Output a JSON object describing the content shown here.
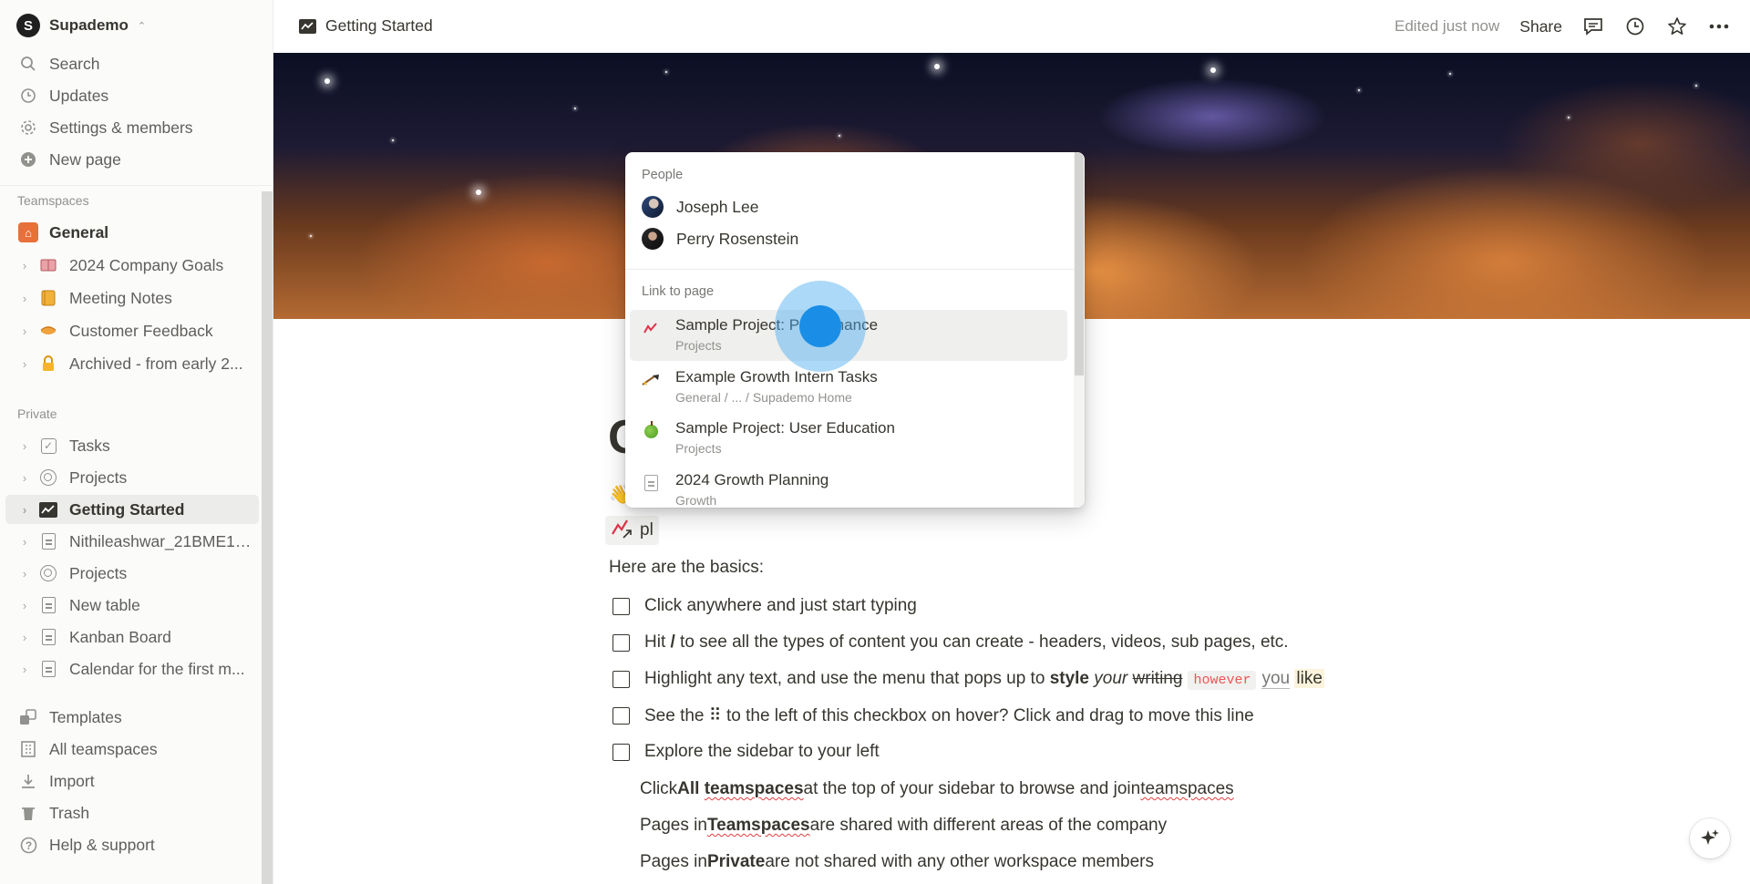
{
  "workspace": {
    "name": "Supademo",
    "logo_letter": "S"
  },
  "sidebar": {
    "top_items": [
      {
        "label": "Search",
        "icon": "search-icon"
      },
      {
        "label": "Updates",
        "icon": "clock-icon"
      },
      {
        "label": "Settings & members",
        "icon": "gear-icon"
      },
      {
        "label": "New page",
        "icon": "plus-circle-icon"
      }
    ],
    "teamspaces_label": "Teamspaces",
    "teamspaces": [
      {
        "label": "General",
        "icon": "home-icon"
      },
      {
        "label": "2024 Company Goals",
        "icon": "book-icon"
      },
      {
        "label": "Meeting Notes",
        "icon": "notebook-icon"
      },
      {
        "label": "Customer Feedback",
        "icon": "pie-icon"
      },
      {
        "label": "Archived - from early 2...",
        "icon": "lock-icon"
      }
    ],
    "private_label": "Private",
    "private": [
      {
        "label": "Tasks",
        "icon": "checkbox-icon"
      },
      {
        "label": "Projects",
        "icon": "target-icon"
      },
      {
        "label": "Getting Started",
        "icon": "chart-icon"
      },
      {
        "label": "Nithileashwar_21BME10...",
        "icon": "document-icon"
      },
      {
        "label": "Projects",
        "icon": "target-icon"
      },
      {
        "label": "New table",
        "icon": "document-icon"
      },
      {
        "label": "Kanban Board",
        "icon": "document-icon"
      },
      {
        "label": "Calendar for the first m...",
        "icon": "document-icon"
      }
    ],
    "bottom_items": [
      {
        "label": "Templates",
        "icon": "templates-icon"
      },
      {
        "label": "All teamspaces",
        "icon": "building-icon"
      },
      {
        "label": "Import",
        "icon": "download-icon"
      },
      {
        "label": "Trash",
        "icon": "trash-icon"
      },
      {
        "label": "Help & support",
        "icon": "help-icon"
      }
    ]
  },
  "topbar": {
    "breadcrumb": "Getting Started",
    "edited": "Edited just now",
    "share": "Share"
  },
  "popup": {
    "people_label": "People",
    "people": [
      "Joseph Lee",
      "Perry Rosenstein"
    ],
    "link_label": "Link to page",
    "pages": [
      {
        "title": "Sample Project: Performance",
        "subtitle": "Projects"
      },
      {
        "title": "Example Growth Intern Tasks",
        "subtitle": "General / ... / Supademo Home"
      },
      {
        "title": "Sample Project: User Education",
        "subtitle": "Projects"
      },
      {
        "title": "2024 Growth Planning",
        "subtitle": "Growth"
      }
    ]
  },
  "doc": {
    "title_fragment": "G",
    "emoji_fragment": "👋",
    "mention_query": "pl",
    "basics": "Here are the basics:",
    "todos": {
      "t1": "Click anywhere and just start typing",
      "t2_a": "Hit ",
      "t2_b": "/",
      "t2_c": " to see all the types of content you can create - headers, videos, sub pages, etc.",
      "t3_a": "Highlight any text, and use the menu that pops up to ",
      "t3_style": "style",
      "t3_your": "your",
      "t3_writing": "writing",
      "t3_however": "however",
      "t3_you": "you",
      "t3_like": "like",
      "t4": "See the ⠿ to the left of this checkbox on hover? Click and drag to move this line",
      "t5": "Explore the sidebar to your left"
    },
    "subs": {
      "s1_a": "Click ",
      "s1_b": "All",
      "s1_c": "teamspaces",
      "s1_d": " at the top of your sidebar to browse and join ",
      "s1_e": "teamspaces",
      "s2_a": "Pages in ",
      "s2_b": "Teamspaces",
      "s2_c": " are shared with different areas of the company",
      "s3_a": "Pages in ",
      "s3_b": "Private",
      "s3_c": " are not shared with any other workspace members"
    }
  },
  "colors": {
    "accent": "#1a8ee6",
    "sidebar_bg": "#fbfbfa",
    "text": "#37352f",
    "muted": "#91918e",
    "code_red": "#eb5757"
  }
}
